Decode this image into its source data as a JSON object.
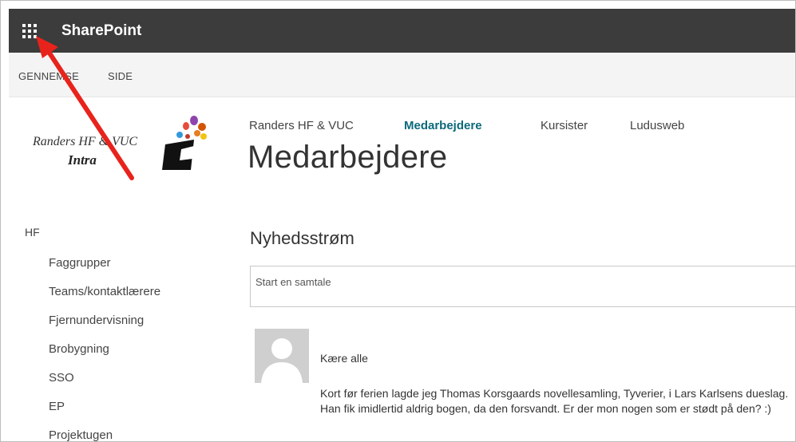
{
  "suitebar": {
    "brand": "SharePoint",
    "waffle_icon": "app-launcher-icon",
    "background": "#3c3c3c"
  },
  "ribbon": {
    "tabs": [
      {
        "label": "GENNEMSE"
      },
      {
        "label": "SIDE"
      }
    ]
  },
  "logo": {
    "line1": "Randers HF & VUC",
    "line2": "Intra"
  },
  "topnav": {
    "items": [
      {
        "label": "Randers HF & VUC",
        "active": false
      },
      {
        "label": "Medarbejdere",
        "active": true
      },
      {
        "label": "Kursister",
        "active": false
      },
      {
        "label": "Ludusweb",
        "active": false
      }
    ],
    "active_color": "#0b6a7a"
  },
  "page": {
    "title": "Medarbejdere"
  },
  "leftnav": {
    "heading": "HF",
    "items": [
      {
        "label": "Faggrupper"
      },
      {
        "label": "Teams/kontaktlærere"
      },
      {
        "label": "Fjernundervisning"
      },
      {
        "label": "Brobygning"
      },
      {
        "label": "SSO"
      },
      {
        "label": "EP"
      },
      {
        "label": "Projektugen"
      }
    ]
  },
  "feed": {
    "title": "Nyhedsstrøm",
    "placeholder": "Start en samtale",
    "posts": [
      {
        "greeting": "Kære alle",
        "body": "Kort før ferien lagde jeg Thomas Korsgaards novellesamling, Tyverier, i Lars Karlsens dueslag. Han fik imidlertid aldrig bogen, da den forsvandt. Er der mon nogen som er stødt på den? :)"
      }
    ]
  },
  "annotation": {
    "arrow_color": "#e8231b"
  }
}
